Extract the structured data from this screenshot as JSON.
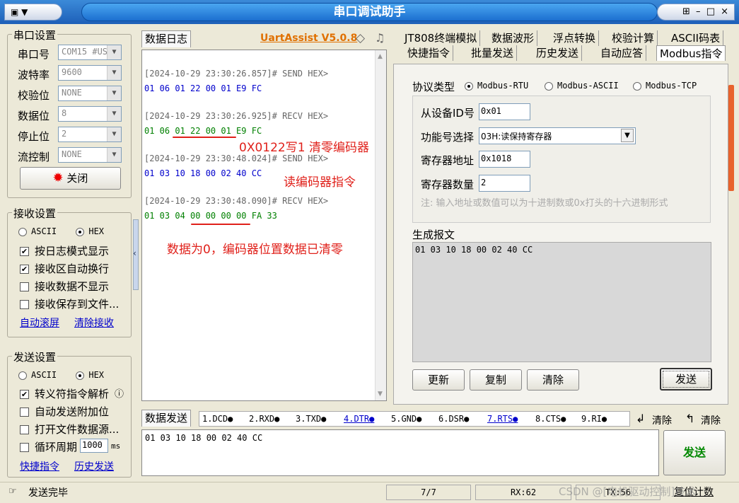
{
  "window": {
    "title": "串口调试助手",
    "sys_menu": "▼",
    "buttons": "⊞ – □ ×"
  },
  "serial": {
    "group": "串口设置",
    "fields": [
      {
        "label": "串口号",
        "value": "COM15 #US"
      },
      {
        "label": "波特率",
        "value": "9600"
      },
      {
        "label": "校验位",
        "value": "NONE"
      },
      {
        "label": "数据位",
        "value": "8"
      },
      {
        "label": "停止位",
        "value": "2"
      },
      {
        "label": "流控制",
        "value": "NONE"
      }
    ],
    "close_btn": "关闭"
  },
  "recv": {
    "group": "接收设置",
    "ascii": "ASCII",
    "hex": "HEX",
    "opts": [
      "按日志模式显示",
      "接收区自动换行",
      "接收数据不显示",
      "接收保存到文件..."
    ],
    "checked": [
      true,
      true,
      false,
      false
    ],
    "link1": "自动滚屏",
    "link2": "清除接收"
  },
  "send": {
    "group": "发送设置",
    "ascii": "ASCII",
    "hex": "HEX",
    "opts": [
      "转义符指令解析",
      "自动发送附加位",
      "打开文件数据源...",
      "循环周期"
    ],
    "checked": [
      true,
      false,
      false,
      false
    ],
    "period": "1000",
    "ms": "ms",
    "info": "ⓘ",
    "link1": "快捷指令",
    "link2": "历史发送"
  },
  "log": {
    "tab": "数据日志",
    "brand": "UartAssist V5.0.8",
    "lines": [
      {
        "t": "[2024-10-29 23:30:26.857]# SEND HEX>",
        "c": "gray"
      },
      {
        "t": "01 06 01 22 00 01 E9 FC",
        "c": "blue"
      },
      {
        "t": "[2024-10-29 23:30:26.925]# RECV HEX>",
        "c": "gray"
      },
      {
        "t": "01 06 01 22 00 01 E9 FC",
        "c": "green"
      },
      {
        "t": "[2024-10-29 23:30:48.024]# SEND HEX>",
        "c": "gray"
      },
      {
        "t": "01 03 10 18 00 02 40 CC",
        "c": "blue"
      },
      {
        "t": "[2024-10-29 23:30:48.090]# RECV HEX>",
        "c": "gray"
      },
      {
        "t": "01 03 04 00 00 00 00 FA 33",
        "c": "green"
      }
    ],
    "ann1": "0X0122写1 清零编码器",
    "ann2": "读编码器指令",
    "ann3": "数据为0，编码器位置数据已清零"
  },
  "tabs_row1": [
    "JT808终端模拟",
    "数据波形",
    "浮点转换",
    "校验计算",
    "ASCII码表"
  ],
  "tabs_row2": [
    "快捷指令",
    "批量发送",
    "历史发送",
    "自动应答",
    "Modbus指令"
  ],
  "modbus": {
    "proto_label": "协议类型",
    "protos": [
      "Modbus-RTU",
      "Modbus-ASCII",
      "Modbus-TCP"
    ],
    "slave_label": "从设备ID号",
    "slave": "0x01",
    "func_label": "功能号选择",
    "func": "03H:读保持寄存器",
    "addr_label": "寄存器地址",
    "addr": "0x1018",
    "count_label": "寄存器数量",
    "count": "2",
    "note": "注: 输入地址或数值可以为十进制数或0x打头的十六进制形式",
    "gen_label": "生成报文",
    "gen": "01 03 10 18 00 02 40 CC",
    "btns": [
      "更新",
      "复制",
      "清除",
      "发送"
    ]
  },
  "sendbar": {
    "tab": "数据发送",
    "signals": [
      "1.DCD●",
      "2.RXD●",
      "3.TXD●",
      "4.DTR●",
      "5.GND●",
      "6.DSR●",
      "7.RTS●",
      "8.CTS●",
      "9.RI●"
    ],
    "clear1": "清除",
    "clear2": "清除",
    "content": "01 03 10 18 00 02 40 CC",
    "send": "发送"
  },
  "status": {
    "msg": "发送完毕",
    "count": "7/7",
    "rx": "RX:62",
    "tx": "TX:56",
    "reset": "复位计数",
    "watermark": "CSDN @[电机驱动控制]技术"
  }
}
